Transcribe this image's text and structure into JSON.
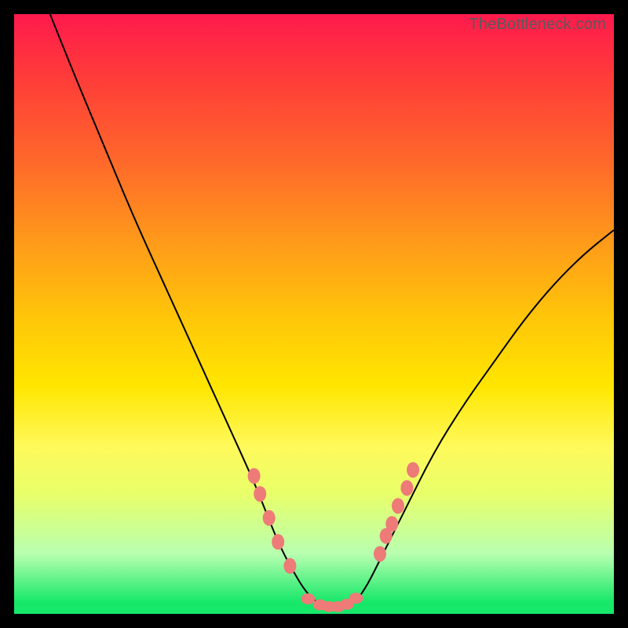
{
  "attribution": "TheBottleneck.com",
  "colors": {
    "frame": "#000000",
    "curve": "#000000",
    "dot": "#ee7b78",
    "gradient_top": "#ff1a4d",
    "gradient_bottom": "#17e86a"
  },
  "chart_data": {
    "type": "line",
    "title": "",
    "xlabel": "",
    "ylabel": "",
    "xlim": [
      0,
      100
    ],
    "ylim": [
      0,
      100
    ],
    "x": [
      6,
      10,
      15,
      20,
      25,
      30,
      35,
      40,
      42,
      44,
      46,
      49,
      52,
      55,
      57,
      59,
      61,
      65,
      70,
      75,
      80,
      85,
      90,
      95,
      100
    ],
    "y": [
      100,
      90,
      78,
      66,
      55,
      44,
      33,
      22,
      17,
      12,
      8,
      3,
      1,
      1,
      2,
      5,
      9,
      17,
      27,
      35,
      42,
      49,
      55,
      60,
      64
    ],
    "left_cluster_points": [
      {
        "x": 40,
        "y": 23
      },
      {
        "x": 41,
        "y": 20
      },
      {
        "x": 42.5,
        "y": 16
      },
      {
        "x": 44,
        "y": 12
      },
      {
        "x": 46,
        "y": 8
      }
    ],
    "bottom_cluster_points": [
      {
        "x": 49,
        "y": 2.5
      },
      {
        "x": 51,
        "y": 1.5
      },
      {
        "x": 52.5,
        "y": 1.2
      },
      {
        "x": 54,
        "y": 1.2
      },
      {
        "x": 55.5,
        "y": 1.6
      },
      {
        "x": 57,
        "y": 2.6
      }
    ],
    "right_cluster_points": [
      {
        "x": 61,
        "y": 10
      },
      {
        "x": 62,
        "y": 13
      },
      {
        "x": 63,
        "y": 15
      },
      {
        "x": 64,
        "y": 18
      },
      {
        "x": 65.5,
        "y": 21
      },
      {
        "x": 66.5,
        "y": 24
      }
    ]
  }
}
